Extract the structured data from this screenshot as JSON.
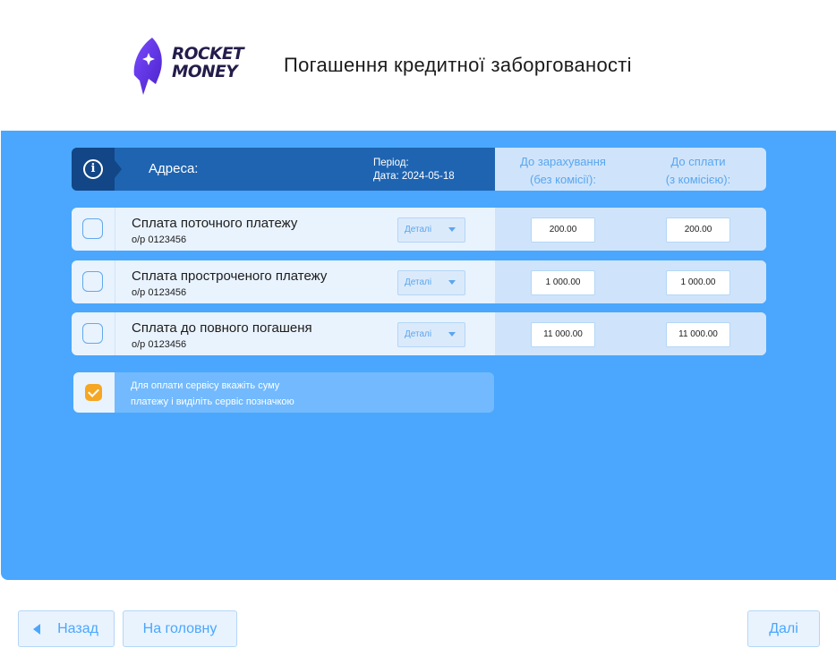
{
  "logo": {
    "line1": "ROCKET",
    "line2": "MONEY"
  },
  "header": {
    "title": "Погашення кредитної заборгованості"
  },
  "table": {
    "address_label": "Адреса:",
    "period_label": "Період:",
    "date_label": "Дата: 2024-05-18",
    "col_credit_line1": "До зарахування",
    "col_credit_line2": "(без комісії):",
    "col_pay_line1": "До сплати",
    "col_pay_line2": "(з комісією):",
    "rows": [
      {
        "title": "Сплата поточного платежу",
        "sub": "о/р 0123456",
        "details": "Деталі",
        "credit": "200.00",
        "pay": "200.00"
      },
      {
        "title": "Сплата простроченого платежу",
        "sub": "о/р 0123456",
        "details": "Деталі",
        "credit": "1 000.00",
        "pay": "1 000.00"
      },
      {
        "title": "Сплата до повного погашеня",
        "sub": "о/р 0123456",
        "details": "Деталі",
        "credit": "11 000.00",
        "pay": "11 000.00"
      }
    ]
  },
  "note": {
    "line1": "Для оплати сервісу вкажіть суму",
    "line2": "платежу і виділіть сервіс позначкою"
  },
  "buttons": {
    "back": "Назад",
    "home": "На головну",
    "next": "Далі"
  },
  "colors": {
    "panel": "#4aa7fd",
    "header_dark": "#1f64b1",
    "accent_orange": "#f5a623",
    "logo_purple": "#5b2de0"
  }
}
